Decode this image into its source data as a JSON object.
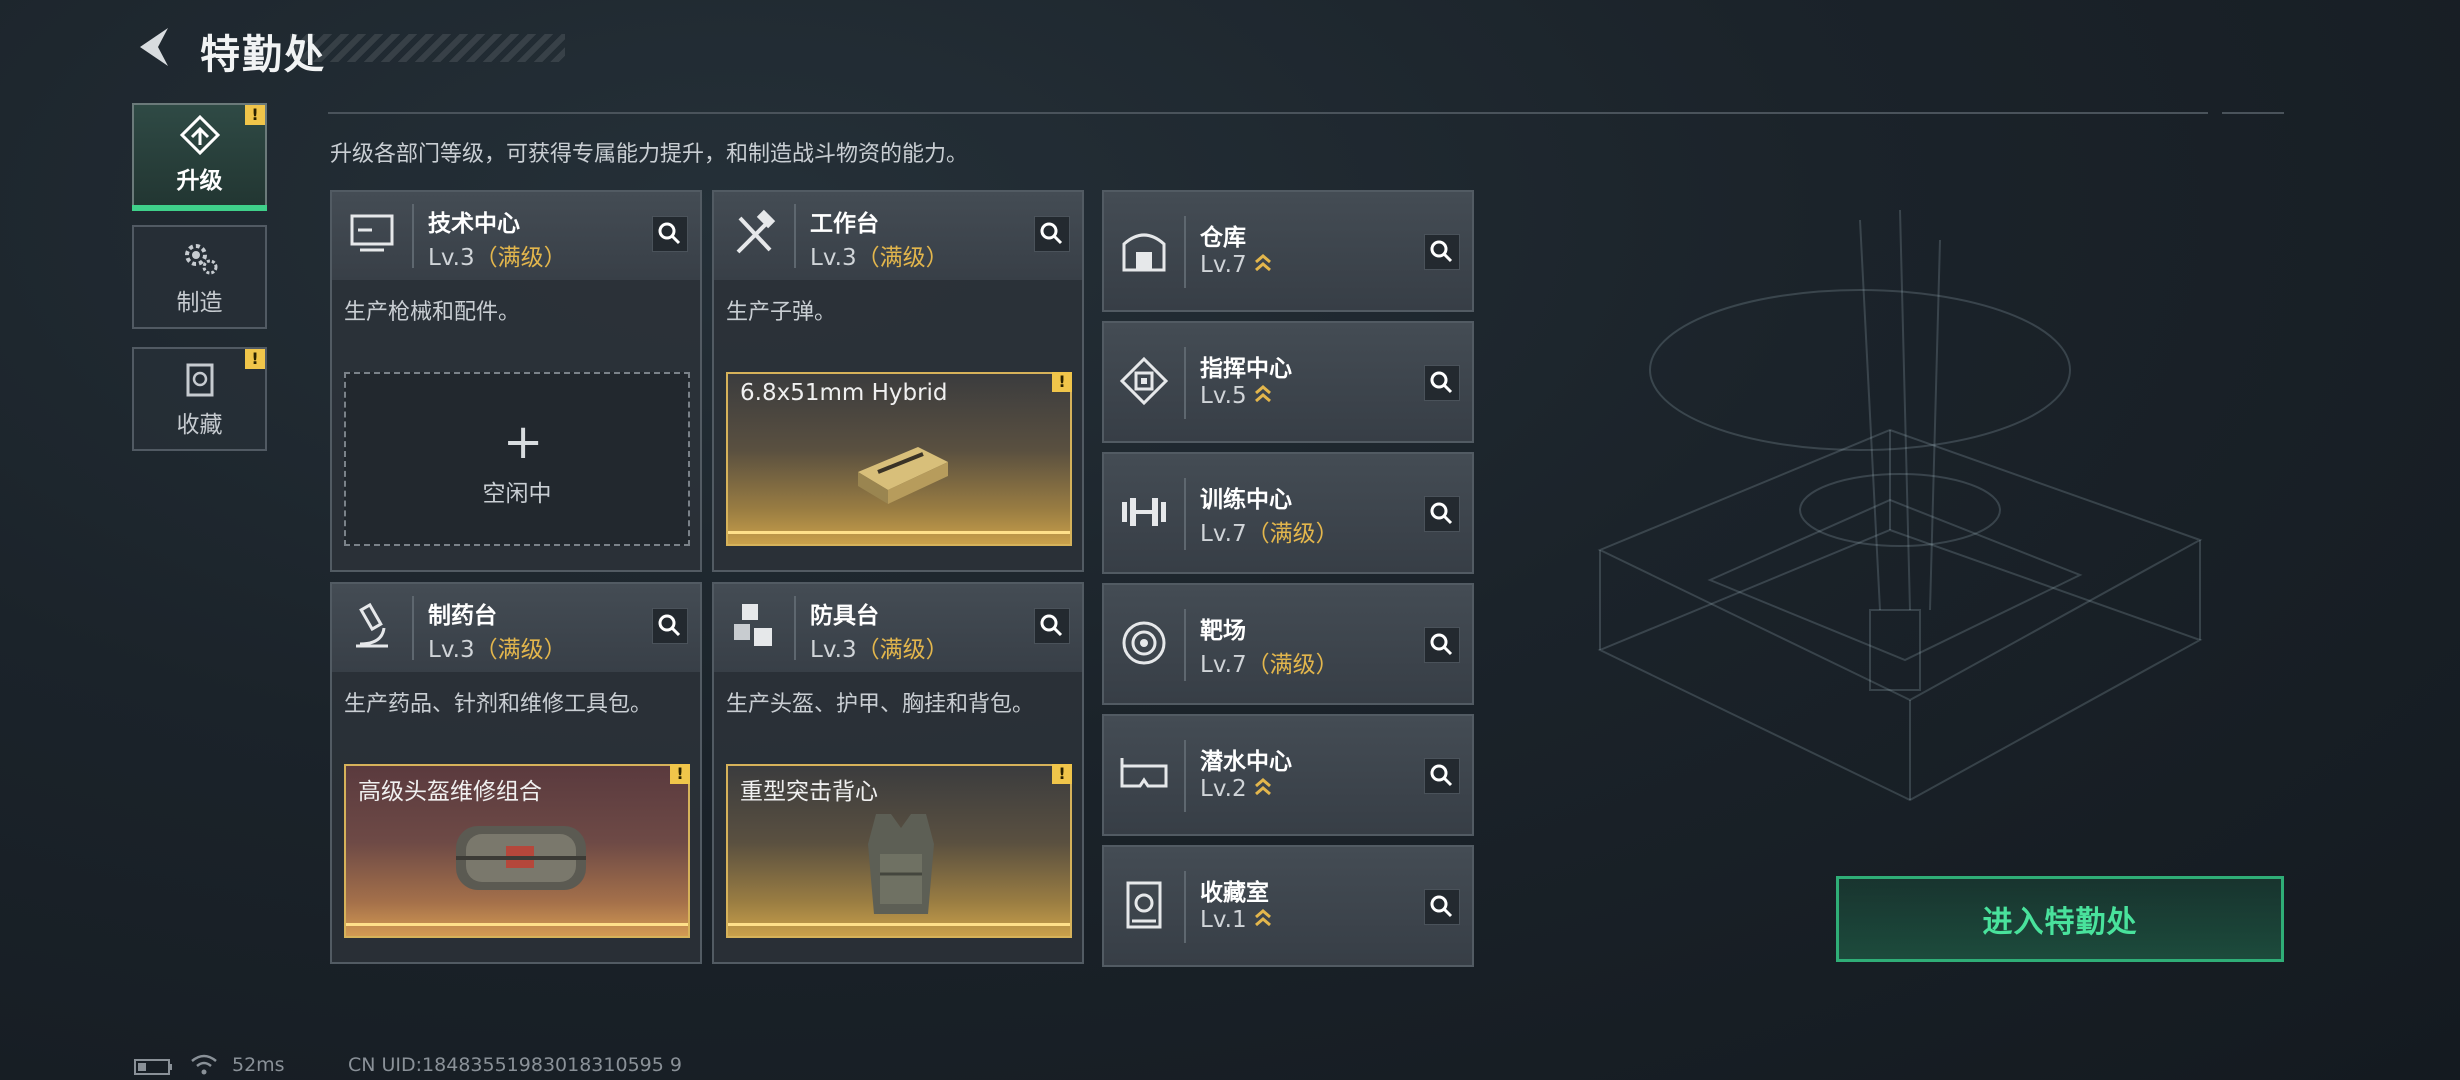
{
  "header": {
    "title": "特勤处"
  },
  "sidebar": {
    "tabs": [
      {
        "label": "升级",
        "icon": "upgrade-icon",
        "active": true,
        "alert": true
      },
      {
        "label": "制造",
        "icon": "gears-icon",
        "active": false,
        "alert": false
      },
      {
        "label": "收藏",
        "icon": "collection-icon",
        "active": false,
        "alert": true
      }
    ]
  },
  "description": "升级各部门等级，可获得专属能力提升，和制造战斗物资的能力。",
  "workshops": [
    {
      "name": "技术中心",
      "level": "Lv.3",
      "max": "（满级）",
      "desc": "生产枪械和配件。",
      "slot_state": "idle",
      "plus": "+",
      "idle_label": "空闲中",
      "icon": "computer-icon"
    },
    {
      "name": "工作台",
      "level": "Lv.3",
      "max": "（满级）",
      "desc": "生产子弹。",
      "slot_state": "item",
      "slot_item": "6.8x51mm Hybrid",
      "icon": "hammer-wrench-icon"
    },
    {
      "name": "制药台",
      "level": "Lv.3",
      "max": "（满级）",
      "desc": "生产药品、针剂和维修工具包。",
      "slot_state": "item",
      "slot_item": "高级头盔维修组合",
      "icon": "microscope-icon"
    },
    {
      "name": "防具台",
      "level": "Lv.3",
      "max": "（满级）",
      "desc": "生产头盔、护甲、胸挂和背包。",
      "slot_state": "item",
      "slot_item": "重型突击背心",
      "icon": "cubes-icon"
    }
  ],
  "departments": [
    {
      "name": "仓库",
      "level": "Lv.7",
      "max": "",
      "upgradable": true,
      "icon": "warehouse-icon"
    },
    {
      "name": "指挥中心",
      "level": "Lv.5",
      "max": "",
      "upgradable": true,
      "icon": "chip-icon"
    },
    {
      "name": "训练中心",
      "level": "Lv.7",
      "max": "（满级）",
      "upgradable": false,
      "icon": "dumbbell-icon"
    },
    {
      "name": "靶场",
      "level": "Lv.7",
      "max": "（满级）",
      "upgradable": false,
      "icon": "target-icon"
    },
    {
      "name": "潜水中心",
      "level": "Lv.2",
      "max": "",
      "upgradable": true,
      "icon": "goggles-icon"
    },
    {
      "name": "收藏室",
      "level": "Lv.1",
      "max": "",
      "upgradable": true,
      "icon": "vault-icon"
    }
  ],
  "enter_button": "进入特勤处",
  "status": {
    "ping": "52ms",
    "uid": "CN UID:18483551983018310595 9"
  },
  "colors": {
    "accent_green": "#3fd08a",
    "max_gold": "#e3b64c",
    "alert_yellow": "#f0c54a"
  }
}
